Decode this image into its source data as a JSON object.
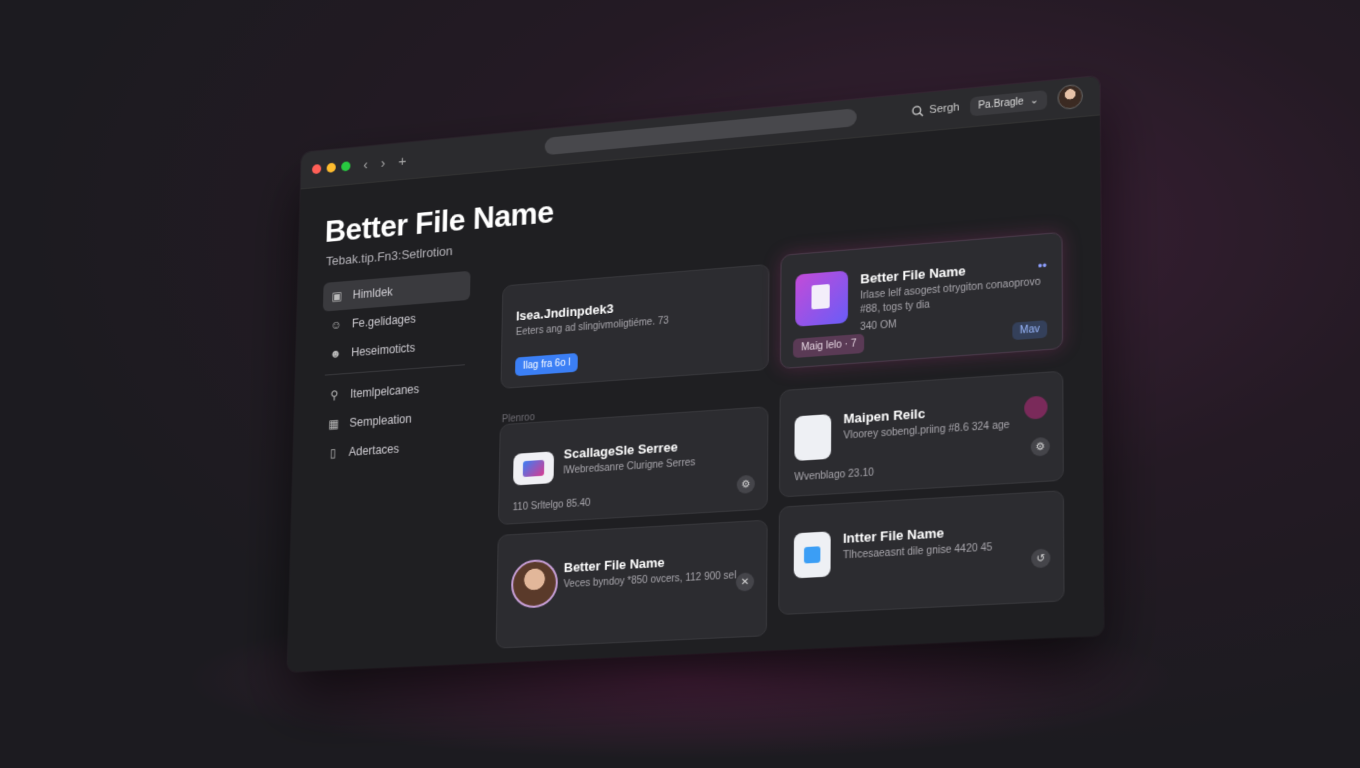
{
  "window": {
    "title": "Better File Name",
    "subtitle": "Tebak.tip.Fn3:Setlrotion",
    "traffic_lights": [
      "#ff5f57",
      "#febc2e",
      "#28c840"
    ]
  },
  "toolbar": {
    "back_icon": "chevron-left-icon",
    "forward_icon": "chevron-right-icon",
    "new_tab_icon": "plus-icon",
    "search_label": "Sergh",
    "select_value": "Pa.Bragle",
    "window_controls": [
      "bell-icon",
      "minimize-icon",
      "restore-icon",
      "maximize-icon"
    ]
  },
  "sidebar": {
    "items": [
      {
        "label": "Himldek",
        "icon": "square-icon",
        "active": true
      },
      {
        "label": "Fe.gelidages",
        "icon": "smiley-icon",
        "active": false
      },
      {
        "label": "Heseimoticts",
        "icon": "user-icon",
        "active": false
      },
      {
        "label": "Itemlpelcanes",
        "icon": "person-search-icon",
        "active": false
      },
      {
        "label": "Sempleation",
        "icon": "grid-icon",
        "active": false
      },
      {
        "label": "Adertaces",
        "icon": "bookmark-icon",
        "active": false
      }
    ]
  },
  "section_label": "Plenroo",
  "cards": {
    "top_left": {
      "title": "Isea.Jndinpdek3",
      "desc": "Eeters ang ad slingivmoligtiéme. 73",
      "button": "Ilag fra 6o l"
    },
    "top_right": {
      "title": "Better File Name",
      "desc": "Irlase lelf asogest otrygiton conaoprovo #88, togs ty dia",
      "size": "340 OM",
      "action": "Mav",
      "tag": "Maig lelo · 7"
    },
    "mid_left": {
      "title": "ScallageSle Serree",
      "desc": "lWebredsanre Clurigne Serres",
      "meta": "110 Srltelgo 85.40"
    },
    "mid_right": {
      "title": "Maipen Reilc",
      "desc": "Vloorey sobengl.priing #8.6 324 age",
      "meta": "Wvenblago 23.10"
    },
    "bottom_left": {
      "title": "Better File Name",
      "desc": "Veces byndoy *850 ovcers, 112 900 sel"
    },
    "bottom_right": {
      "title": "Intter File Name",
      "desc": "Tlhcesaeasnt dile gnise 4420 45"
    }
  },
  "colors": {
    "accent_blue": "#3b7ff5",
    "accent_pink": "#d83a8f",
    "accent_purple": "#8a5cf6"
  }
}
